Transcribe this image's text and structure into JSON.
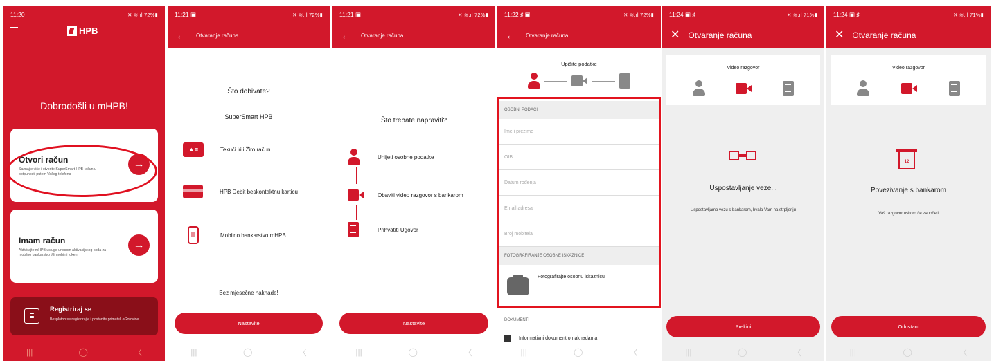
{
  "screens": [
    {
      "time": "11:20",
      "status": "✕ ≋.ıl 72%▮",
      "brand": "HPB",
      "welcome": "Dobrodošli u mHPB!",
      "card1": {
        "title": "Otvori račun",
        "sub": "Saznajte više i otvorite SuperSmart HPB račun u potpunosti putem Vašeg telefona"
      },
      "card2": {
        "title": "Imam račun",
        "sub": "Aktivirajte mHPB usluge unosom aktivacijskog koda za mobilno bankarstvo i/ili mobilni token"
      },
      "register": {
        "title": "Registriraj se",
        "sub": "Besplatno se registrirajte i postanite primatelj eGotovine"
      }
    },
    {
      "time": "11:21 ▣",
      "status": "✕ ≋.ıl 72%▮",
      "title": "Otvaranje računa",
      "heading": "Što dobivate?",
      "product": "SuperSmart HPB",
      "features": [
        "Tekući i/ili Žiro račun",
        "HPB Debit beskontaktnu karticu",
        "Mobilno bankarstvo mHPB"
      ],
      "footer": "Bez mjesečne naknade!",
      "button": "Nastavite"
    },
    {
      "time": "11:21 ▣",
      "status": "✕ ≋.ıl 72%▮",
      "title": "Otvaranje računa",
      "heading": "Što trebate napraviti?",
      "steps": [
        "Unijeti osobne podatke",
        "Obaviti video razgovor s bankarom",
        "Prihvatiti Ugovor"
      ],
      "button": "Nastavite"
    },
    {
      "time": "11:22 ♯ ▣",
      "status": "✕ ≋.ıl 72%▮",
      "title": "Otvaranje računa",
      "step": "Upišite podatke",
      "section1": "OSOBNI PODACI",
      "fields": [
        "Ime i prezime",
        "OIB",
        "Datum rođenja",
        "Email adresa",
        "Broj mobitela"
      ],
      "section2": "FOTOGRAFIRANJE OSOBNE ISKAZNICE",
      "photo": "Fotografirajte osobnu iskaznicu",
      "section3": "DOKUMENTI",
      "doc": "Informativni dokument o naknadama"
    },
    {
      "time": "11:24 ▣ ♯",
      "status": "✕ ≋.ıl 71%▮",
      "title": "Otvaranje računa",
      "step": "Video razgovor",
      "heading": "Uspostavljanje veze...",
      "sub": "Uspostavljamo vezu s bankarom, hvala Vam na strpljenju",
      "button": "Prekini"
    },
    {
      "time": "11:24 ▣ ♯",
      "status": "✕ ≋.ıl 71%▮",
      "title": "Otvaranje računa",
      "step": "Video razgovor",
      "calendar": "12",
      "heading": "Povezivanje s bankarom",
      "sub": "Vaš razgovor uskoro će započeti",
      "button": "Odustani"
    }
  ],
  "nav": [
    "|||",
    "◯",
    "〈"
  ],
  "colors": {
    "brand": "#d2182b",
    "dark_red": "#8a0f19"
  }
}
